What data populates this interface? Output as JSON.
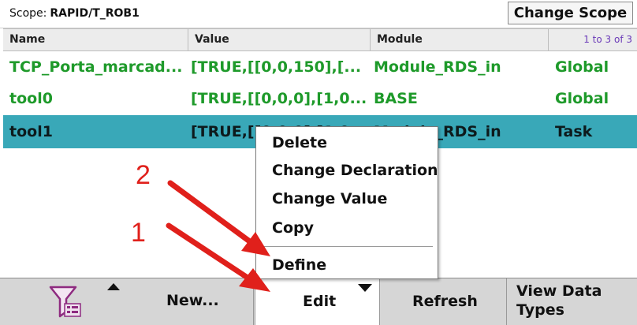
{
  "scope": {
    "label": "Scope:",
    "value": "RAPID/T_ROB1",
    "change_button": "Change Scope"
  },
  "table": {
    "headers": [
      "Name",
      "Value",
      "Module"
    ],
    "pager": "1 to 3 of 3",
    "rows": [
      {
        "name": "TCP_Porta_marcad...",
        "value": "[TRUE,[[0,0,150],[...",
        "module": "Module_RDS_in",
        "scope": "Global"
      },
      {
        "name": "tool0",
        "value": "[TRUE,[[0,0,0],[1,0...",
        "module": "BASE",
        "scope": "Global"
      },
      {
        "name": "tool1",
        "value": "[TRUE,[[0,0,0],[1,0...",
        "module": "Module_RDS_in",
        "scope": "Task"
      }
    ]
  },
  "context_menu": {
    "items": [
      "Delete",
      "Change Declaration",
      "Change Value",
      "Copy",
      "Define"
    ]
  },
  "toolbar": {
    "new_label": "New...",
    "edit_label": "Edit",
    "refresh_label": "Refresh",
    "view_types_label": "View Data Types"
  },
  "annotations": {
    "step_1": "1",
    "step_2": "2"
  },
  "colors": {
    "text_green": "#1e9a2a",
    "selected_row": "#39a8b8",
    "annotation_red": "#e0201b",
    "pager_purple": "#6a39b8"
  },
  "icons": {
    "filter": "filter-funnel-icon",
    "menu_up": "triangle-up-icon",
    "menu_down": "triangle-down-icon"
  }
}
